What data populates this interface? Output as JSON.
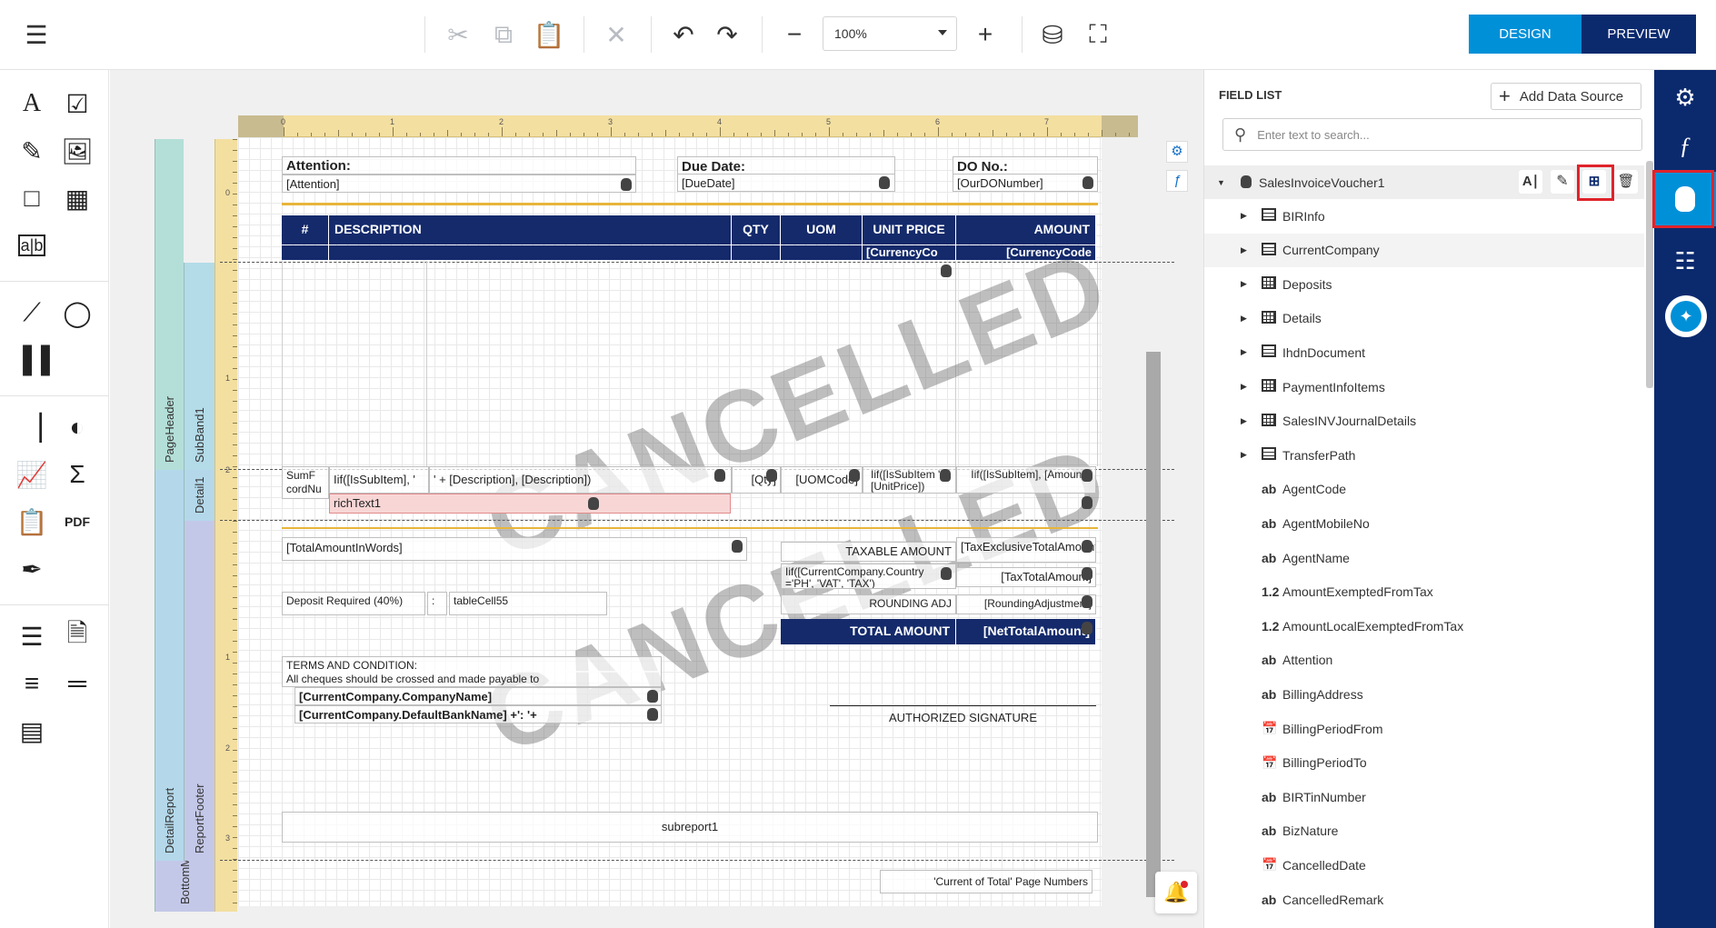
{
  "toolbar": {
    "zoom": "100%",
    "design_label": "DESIGN",
    "preview_label": "PREVIEW",
    "colors": {
      "design_bg": "#0090d8",
      "preview_bg": "#0b2a6e"
    }
  },
  "report": {
    "attention_label": "Attention:",
    "attention_field": "[Attention]",
    "due_label": "Due Date:",
    "due_field": "[DueDate]",
    "do_label": "DO No.:",
    "do_field": "[OurDONumber]",
    "headers": [
      "#",
      "DESCRIPTION",
      "QTY",
      "UOM",
      "UNIT PRICE",
      "AMOUNT"
    ],
    "currency1": "[CurrencyCo",
    "currency2": "[CurrencyCode",
    "detail": {
      "sum": "SumF cordNu",
      "iif_desc": "Iif([IsSubItem], '",
      "desc_tail": "' + [Description], [Description])",
      "qty": "[Qty]",
      "uom": "[UOMCode]",
      "iif_price": "Iif([IsSubItem ', [UnitPrice])",
      "iif_amount": "Iif([IsSubItem], [Amount])",
      "richtext": "richText1"
    },
    "footer": {
      "words": "[TotalAmountInWords]",
      "taxable_label": "TAXABLE AMOUNT",
      "taxable_value": "[TaxExclusiveTotalAmount]",
      "tax_label": "Iif([CurrentCompany.Country ='PH', 'VAT', 'TAX')",
      "tax_value": "[TaxTotalAmount]",
      "rounding_label": "ROUNDING ADJ",
      "rounding_value": "[RoundingAdjustment]",
      "total_label": "TOTAL AMOUNT",
      "total_value": "[NetTotalAmount]",
      "deposit": "Deposit Required (40%)",
      "colon": ":",
      "tablecell": "tableCell55",
      "terms1": "TERMS AND CONDITION:",
      "terms2": "All cheques should be crossed and made payable to",
      "company_name": "[CurrentCompany.CompanyName]",
      "bank_name": "[CurrentCompany.DefaultBankName] +': '+",
      "signature": "AUTHORIZED SIGNATURE",
      "subreport": "subreport1",
      "page_numbers": "'Current of Total' Page Numbers"
    },
    "watermark": "CANCELLED",
    "bands": {
      "pageheader": "PageHeader",
      "subband": "SubBand1",
      "detail": "Detail1",
      "detailreport": "DetailReport",
      "reportfooter": "ReportFooter",
      "bottom": "BottomMargin"
    }
  },
  "field_list": {
    "title": "FIELD LIST",
    "add_label": "Add Data Source",
    "search_placeholder": "Enter text to search...",
    "root": "SalesInvoiceVoucher1",
    "items": [
      {
        "label": "BIRInfo",
        "icon": "table"
      },
      {
        "label": "CurrentCompany",
        "icon": "table"
      },
      {
        "label": "Deposits",
        "icon": "grid"
      },
      {
        "label": "Details",
        "icon": "grid"
      },
      {
        "label": "IhdnDocument",
        "icon": "table"
      },
      {
        "label": "PaymentInfoItems",
        "icon": "grid"
      },
      {
        "label": "SalesINVJournalDetails",
        "icon": "grid"
      },
      {
        "label": "TransferPath",
        "icon": "table"
      },
      {
        "label": "AgentCode",
        "icon": "ab"
      },
      {
        "label": "AgentMobileNo",
        "icon": "ab"
      },
      {
        "label": "AgentName",
        "icon": "ab"
      },
      {
        "label": "AmountExemptedFromTax",
        "icon": "1.2"
      },
      {
        "label": "AmountLocalExemptedFromTax",
        "icon": "1.2"
      },
      {
        "label": "Attention",
        "icon": "ab"
      },
      {
        "label": "BillingAddress",
        "icon": "ab"
      },
      {
        "label": "BillingPeriodFrom",
        "icon": "date"
      },
      {
        "label": "BillingPeriodTo",
        "icon": "date"
      },
      {
        "label": "BIRTinNumber",
        "icon": "ab"
      },
      {
        "label": "BizNature",
        "icon": "ab"
      },
      {
        "label": "CancelledDate",
        "icon": "date"
      },
      {
        "label": "CancelledRemark",
        "icon": "ab"
      }
    ]
  }
}
